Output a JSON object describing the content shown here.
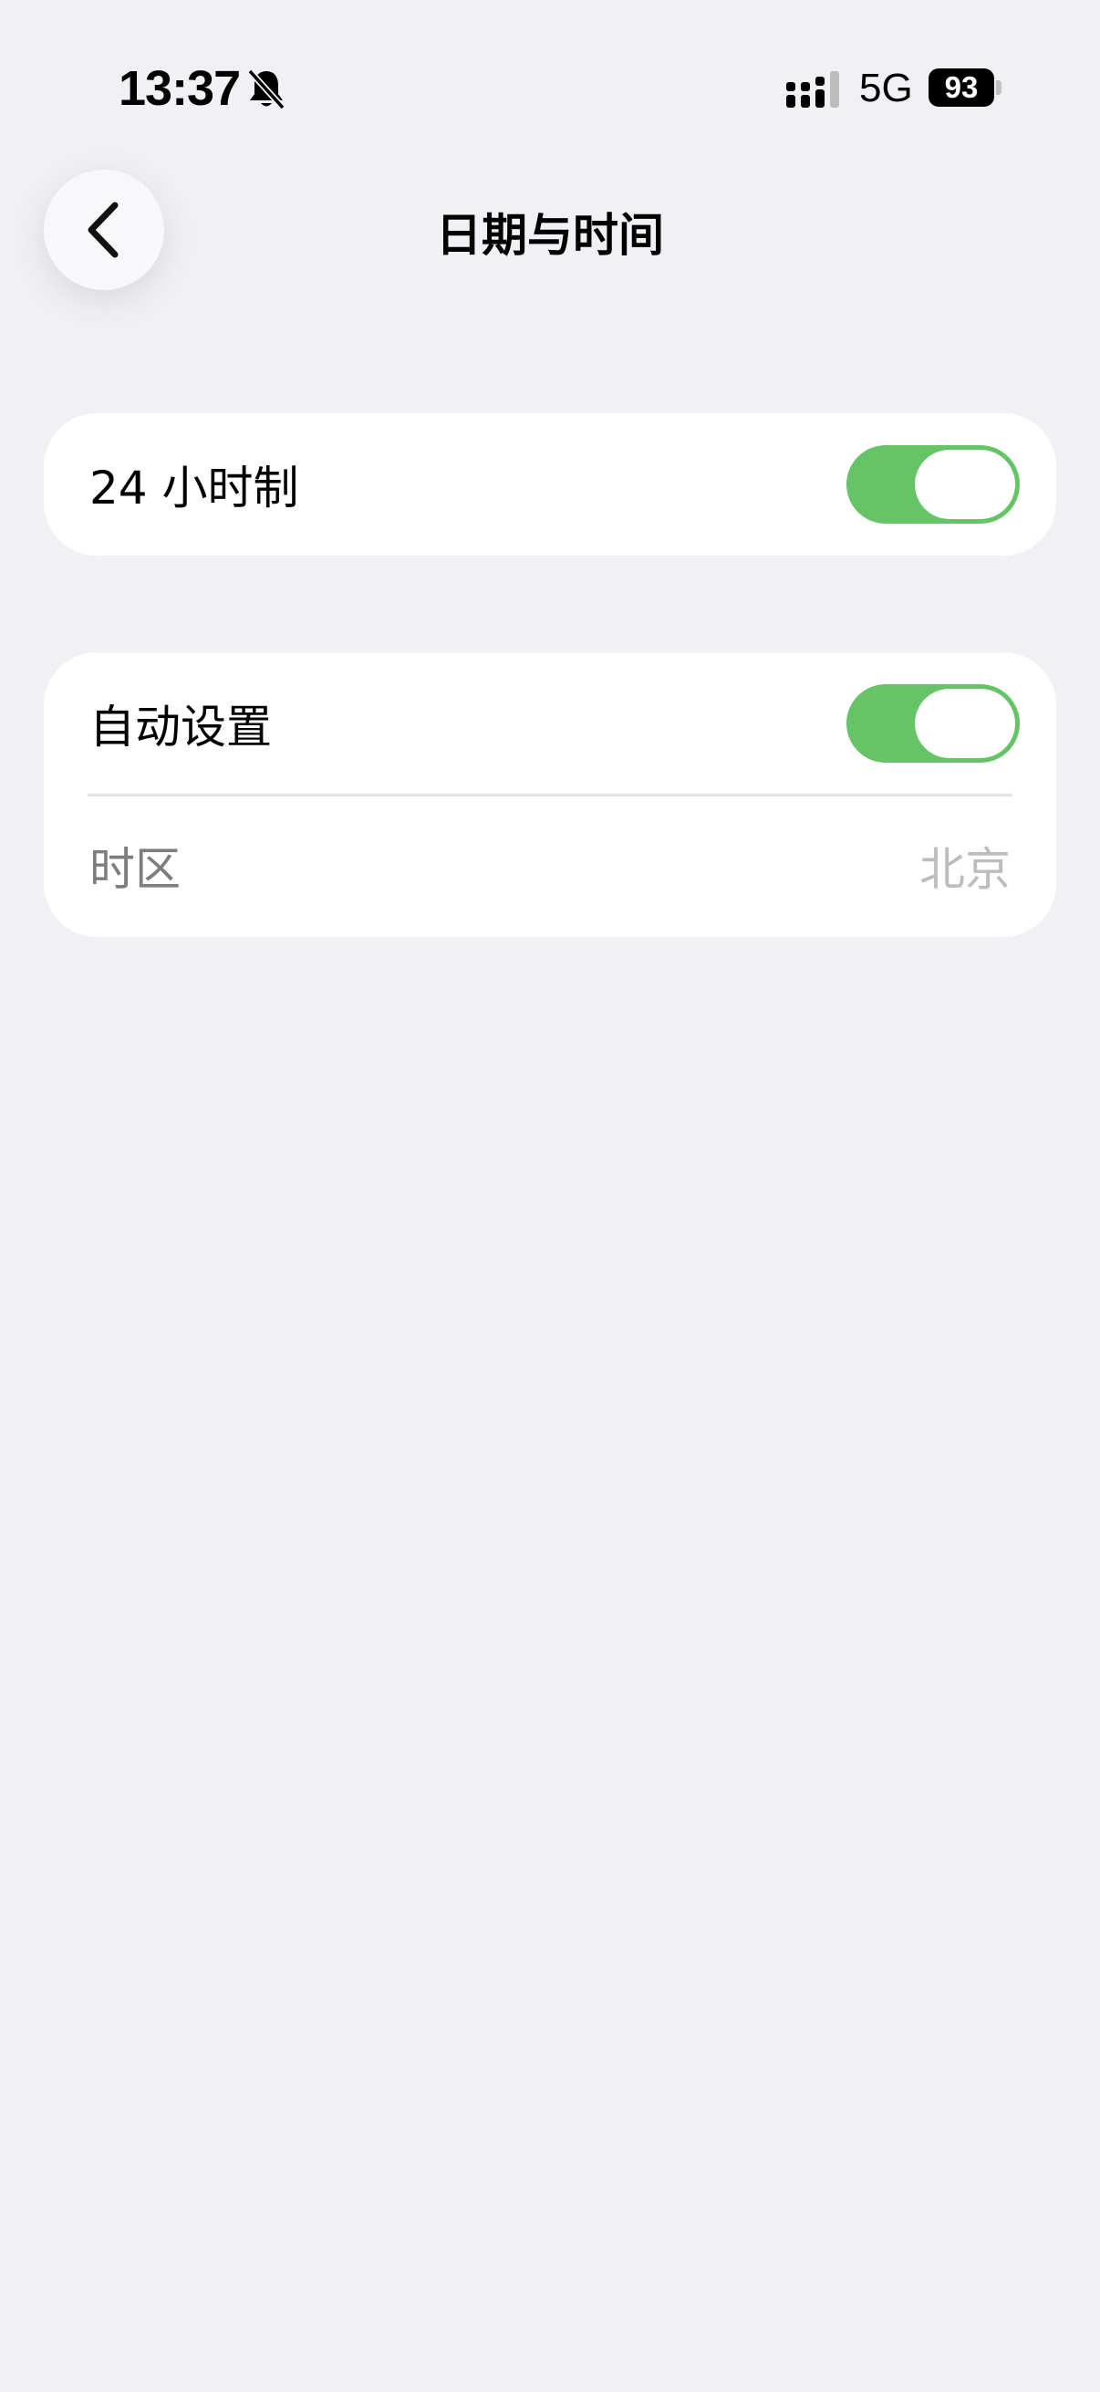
{
  "status_bar": {
    "time": "13:37",
    "mute_icon": "bell-slash-icon",
    "signal_icon": "cellular-signal-icon",
    "network": "5G",
    "battery": "93"
  },
  "nav": {
    "back_icon": "chevron-left-icon",
    "title": "日期与时间"
  },
  "settings": {
    "hour24": {
      "label": "24 小时制",
      "enabled": true
    },
    "auto_set": {
      "label": "自动设置",
      "enabled": true
    },
    "timezone": {
      "label": "时区",
      "value": "北京"
    }
  },
  "colors": {
    "background": "#f1f0f5",
    "toggle_on": "#65c466",
    "card": "#ffffff"
  }
}
